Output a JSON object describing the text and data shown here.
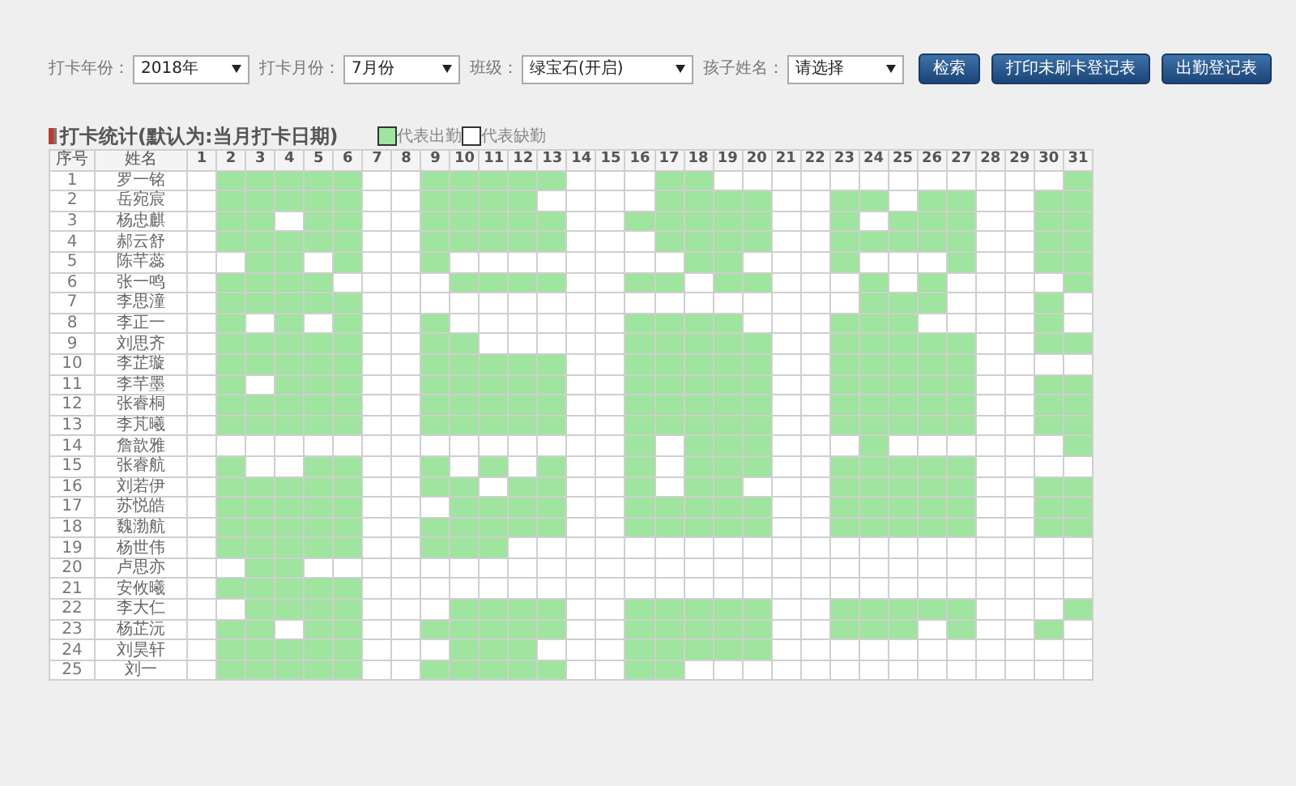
{
  "filters": [
    {
      "label": "打卡年份：",
      "value": "2018年"
    },
    {
      "label": "打卡月份：",
      "value": "7月份"
    },
    {
      "label": "班级：",
      "value": "绿宝石(开启)"
    },
    {
      "label": "孩子姓名：",
      "value": "请选择"
    }
  ],
  "buttons": [
    "检索",
    "打印未刷卡登记表",
    "出勤登记表"
  ],
  "section_title": "打卡统计(默认为:当月打卡日期)",
  "legend": [
    {
      "label": "代表出勤",
      "present": true
    },
    {
      "label": "代表缺勤",
      "present": false
    }
  ],
  "table": {
    "columns": [
      "序号",
      "姓名",
      "1",
      "2",
      "3",
      "4",
      "5",
      "6",
      "7",
      "8",
      "9",
      "10",
      "11",
      "12",
      "13",
      "14",
      "15",
      "16",
      "17",
      "18",
      "19",
      "20",
      "21",
      "22",
      "23",
      "24",
      "25",
      "26",
      "27",
      "28",
      "29",
      "30",
      "31"
    ],
    "rows": [
      {
        "index": "1",
        "name": "罗一铭",
        "days": [
          false,
          true,
          true,
          true,
          true,
          true,
          false,
          false,
          true,
          true,
          true,
          true,
          true,
          false,
          false,
          false,
          true,
          true,
          false,
          false,
          false,
          false,
          false,
          false,
          false,
          false,
          false,
          false,
          false,
          false,
          true
        ]
      },
      {
        "index": "2",
        "name": "岳宛宸",
        "days": [
          false,
          true,
          true,
          true,
          true,
          true,
          false,
          false,
          true,
          true,
          true,
          true,
          false,
          false,
          false,
          false,
          true,
          true,
          true,
          true,
          false,
          false,
          true,
          true,
          false,
          true,
          true,
          false,
          false,
          true,
          true
        ]
      },
      {
        "index": "3",
        "name": "杨忠麒",
        "days": [
          false,
          true,
          true,
          false,
          true,
          true,
          false,
          false,
          true,
          true,
          true,
          true,
          true,
          false,
          false,
          true,
          true,
          true,
          true,
          true,
          false,
          false,
          true,
          false,
          true,
          true,
          true,
          false,
          false,
          true,
          true
        ]
      },
      {
        "index": "4",
        "name": "郝云舒",
        "days": [
          false,
          true,
          true,
          true,
          true,
          true,
          false,
          false,
          true,
          true,
          true,
          true,
          true,
          false,
          false,
          false,
          true,
          true,
          true,
          true,
          false,
          false,
          true,
          true,
          true,
          true,
          true,
          false,
          false,
          true,
          true
        ]
      },
      {
        "index": "5",
        "name": "陈芊蕊",
        "days": [
          false,
          false,
          true,
          true,
          false,
          true,
          false,
          false,
          true,
          false,
          false,
          false,
          false,
          false,
          false,
          false,
          false,
          true,
          true,
          false,
          false,
          false,
          true,
          false,
          false,
          false,
          true,
          false,
          false,
          true,
          true
        ]
      },
      {
        "index": "6",
        "name": "张一鸣",
        "days": [
          false,
          true,
          true,
          true,
          true,
          false,
          false,
          false,
          false,
          true,
          true,
          true,
          true,
          false,
          false,
          true,
          true,
          false,
          true,
          true,
          false,
          false,
          false,
          true,
          false,
          true,
          false,
          false,
          false,
          false,
          true
        ]
      },
      {
        "index": "7",
        "name": "李思潼",
        "days": [
          false,
          true,
          true,
          true,
          true,
          true,
          false,
          false,
          false,
          false,
          false,
          false,
          false,
          false,
          false,
          false,
          false,
          false,
          false,
          false,
          false,
          false,
          false,
          true,
          true,
          true,
          false,
          false,
          false,
          true,
          false
        ]
      },
      {
        "index": "8",
        "name": "李正一",
        "days": [
          false,
          true,
          false,
          true,
          false,
          true,
          false,
          false,
          true,
          false,
          false,
          false,
          false,
          false,
          false,
          true,
          true,
          true,
          true,
          false,
          false,
          false,
          true,
          true,
          true,
          false,
          false,
          false,
          false,
          true,
          false
        ]
      },
      {
        "index": "9",
        "name": "刘思齐",
        "days": [
          false,
          true,
          true,
          true,
          true,
          true,
          false,
          false,
          true,
          true,
          false,
          false,
          false,
          false,
          false,
          true,
          true,
          true,
          true,
          true,
          false,
          false,
          true,
          true,
          true,
          true,
          true,
          false,
          false,
          true,
          true
        ]
      },
      {
        "index": "10",
        "name": "李芷璇",
        "days": [
          false,
          true,
          true,
          true,
          true,
          true,
          false,
          false,
          true,
          true,
          true,
          true,
          true,
          false,
          false,
          true,
          true,
          true,
          true,
          true,
          false,
          false,
          true,
          true,
          true,
          true,
          true,
          false,
          false,
          false,
          false
        ]
      },
      {
        "index": "11",
        "name": "李芊墨",
        "days": [
          false,
          true,
          false,
          true,
          true,
          true,
          false,
          false,
          true,
          true,
          true,
          true,
          true,
          false,
          false,
          true,
          true,
          true,
          true,
          true,
          false,
          false,
          true,
          true,
          true,
          true,
          true,
          false,
          false,
          true,
          true
        ]
      },
      {
        "index": "12",
        "name": "张睿桐",
        "days": [
          false,
          true,
          true,
          true,
          true,
          true,
          false,
          false,
          true,
          true,
          true,
          true,
          true,
          false,
          false,
          true,
          true,
          true,
          true,
          true,
          false,
          false,
          true,
          true,
          true,
          true,
          true,
          false,
          false,
          true,
          true
        ]
      },
      {
        "index": "13",
        "name": "李芃曦",
        "days": [
          false,
          true,
          true,
          true,
          true,
          true,
          false,
          false,
          true,
          true,
          true,
          true,
          true,
          false,
          false,
          true,
          true,
          true,
          true,
          true,
          false,
          false,
          true,
          true,
          true,
          true,
          true,
          false,
          false,
          true,
          true
        ]
      },
      {
        "index": "14",
        "name": "詹歆雅",
        "days": [
          false,
          false,
          false,
          false,
          false,
          false,
          false,
          false,
          false,
          false,
          false,
          false,
          false,
          false,
          false,
          true,
          false,
          true,
          true,
          true,
          false,
          false,
          false,
          true,
          false,
          false,
          false,
          false,
          false,
          false,
          true
        ]
      },
      {
        "index": "15",
        "name": "张睿航",
        "days": [
          false,
          true,
          false,
          false,
          true,
          true,
          false,
          false,
          true,
          false,
          true,
          false,
          true,
          false,
          false,
          true,
          false,
          true,
          true,
          true,
          false,
          false,
          true,
          true,
          true,
          true,
          true,
          false,
          false,
          false,
          false
        ]
      },
      {
        "index": "16",
        "name": "刘若伊",
        "days": [
          false,
          true,
          true,
          true,
          true,
          true,
          false,
          false,
          true,
          true,
          false,
          true,
          true,
          false,
          false,
          true,
          false,
          true,
          true,
          false,
          false,
          false,
          true,
          true,
          true,
          true,
          true,
          false,
          false,
          true,
          true
        ]
      },
      {
        "index": "17",
        "name": "苏悦皓",
        "days": [
          false,
          true,
          true,
          true,
          true,
          true,
          false,
          false,
          false,
          true,
          true,
          true,
          true,
          false,
          false,
          true,
          true,
          true,
          true,
          true,
          false,
          false,
          true,
          true,
          true,
          true,
          true,
          false,
          false,
          true,
          true
        ]
      },
      {
        "index": "18",
        "name": "魏渤航",
        "days": [
          false,
          true,
          true,
          true,
          true,
          true,
          false,
          false,
          true,
          true,
          true,
          true,
          true,
          false,
          false,
          true,
          true,
          true,
          true,
          true,
          false,
          false,
          true,
          true,
          true,
          true,
          true,
          false,
          false,
          true,
          true
        ]
      },
      {
        "index": "19",
        "name": "杨世伟",
        "days": [
          false,
          true,
          true,
          true,
          true,
          true,
          false,
          false,
          true,
          true,
          true,
          false,
          false,
          false,
          false,
          false,
          false,
          false,
          false,
          false,
          false,
          false,
          false,
          false,
          false,
          false,
          false,
          false,
          false,
          false,
          false
        ]
      },
      {
        "index": "20",
        "name": "卢思亦",
        "days": [
          false,
          false,
          true,
          true,
          false,
          false,
          false,
          false,
          false,
          false,
          false,
          false,
          false,
          false,
          false,
          false,
          false,
          false,
          false,
          false,
          false,
          false,
          false,
          false,
          false,
          false,
          false,
          false,
          false,
          false,
          false
        ]
      },
      {
        "index": "21",
        "name": "安攸曦",
        "days": [
          false,
          true,
          true,
          true,
          true,
          true,
          false,
          false,
          false,
          false,
          false,
          false,
          false,
          false,
          false,
          false,
          false,
          false,
          false,
          false,
          false,
          false,
          false,
          false,
          false,
          false,
          false,
          false,
          false,
          false,
          false
        ]
      },
      {
        "index": "22",
        "name": "李大仁",
        "days": [
          false,
          false,
          true,
          true,
          true,
          true,
          false,
          false,
          false,
          true,
          true,
          true,
          true,
          false,
          false,
          true,
          true,
          true,
          true,
          true,
          false,
          false,
          true,
          true,
          true,
          true,
          true,
          false,
          false,
          false,
          true
        ]
      },
      {
        "index": "23",
        "name": "杨芷沅",
        "days": [
          false,
          true,
          true,
          false,
          true,
          true,
          false,
          false,
          true,
          true,
          true,
          true,
          true,
          false,
          false,
          true,
          true,
          true,
          true,
          true,
          false,
          false,
          true,
          true,
          true,
          false,
          true,
          false,
          false,
          true,
          false
        ]
      },
      {
        "index": "24",
        "name": "刘昊轩",
        "days": [
          false,
          true,
          true,
          true,
          true,
          true,
          false,
          false,
          false,
          true,
          true,
          true,
          false,
          false,
          false,
          true,
          true,
          true,
          true,
          true,
          false,
          false,
          false,
          false,
          false,
          false,
          false,
          false,
          false,
          false,
          false
        ]
      },
      {
        "index": "25",
        "name": "刘一",
        "days": [
          false,
          true,
          true,
          true,
          true,
          true,
          false,
          false,
          true,
          true,
          true,
          true,
          true,
          false,
          false,
          true,
          true,
          false,
          false,
          false,
          false,
          false,
          false,
          false,
          false,
          false,
          false,
          false,
          false,
          false,
          false
        ]
      }
    ]
  }
}
